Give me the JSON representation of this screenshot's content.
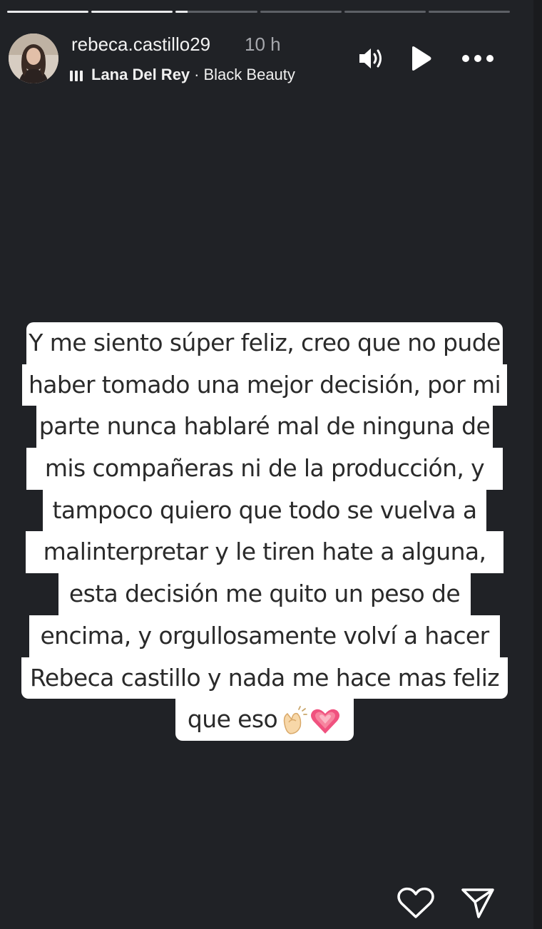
{
  "story": {
    "progress": [
      1.0,
      1.0,
      0.15,
      0.0,
      0.0,
      0.0
    ],
    "username": "rebeca.castillo29",
    "time_ago": "10 h",
    "music": {
      "artist": "Lana Del Rey",
      "separator": "·",
      "song": "Black Beauty"
    },
    "text_lines": [
      "Y me siento súper feliz, creo que no pude",
      "haber tomado una mejor decisión, por mi",
      "parte nunca hablaré mal de ninguna de",
      "mis compañeras ni de la producción, y",
      "tampoco quiero que todo se vuelva a",
      "malinterpretar y le tiren hate a alguna,",
      "esta decisión me quito un peso de",
      "encima, y orgullosamente volví a hacer",
      "Rebeca castillo y nada me hace mas feliz",
      "que eso"
    ]
  },
  "icons": {
    "header": [
      "volume-icon",
      "play-icon",
      "more-icon"
    ],
    "footer": [
      "heart-icon",
      "share-icon"
    ],
    "emoji": [
      "clapping-hands-icon",
      "pink-heart-icon"
    ]
  },
  "colors": {
    "background": "#202226",
    "text_card": "#ffffff",
    "heart_emoji": "#f0527f"
  }
}
